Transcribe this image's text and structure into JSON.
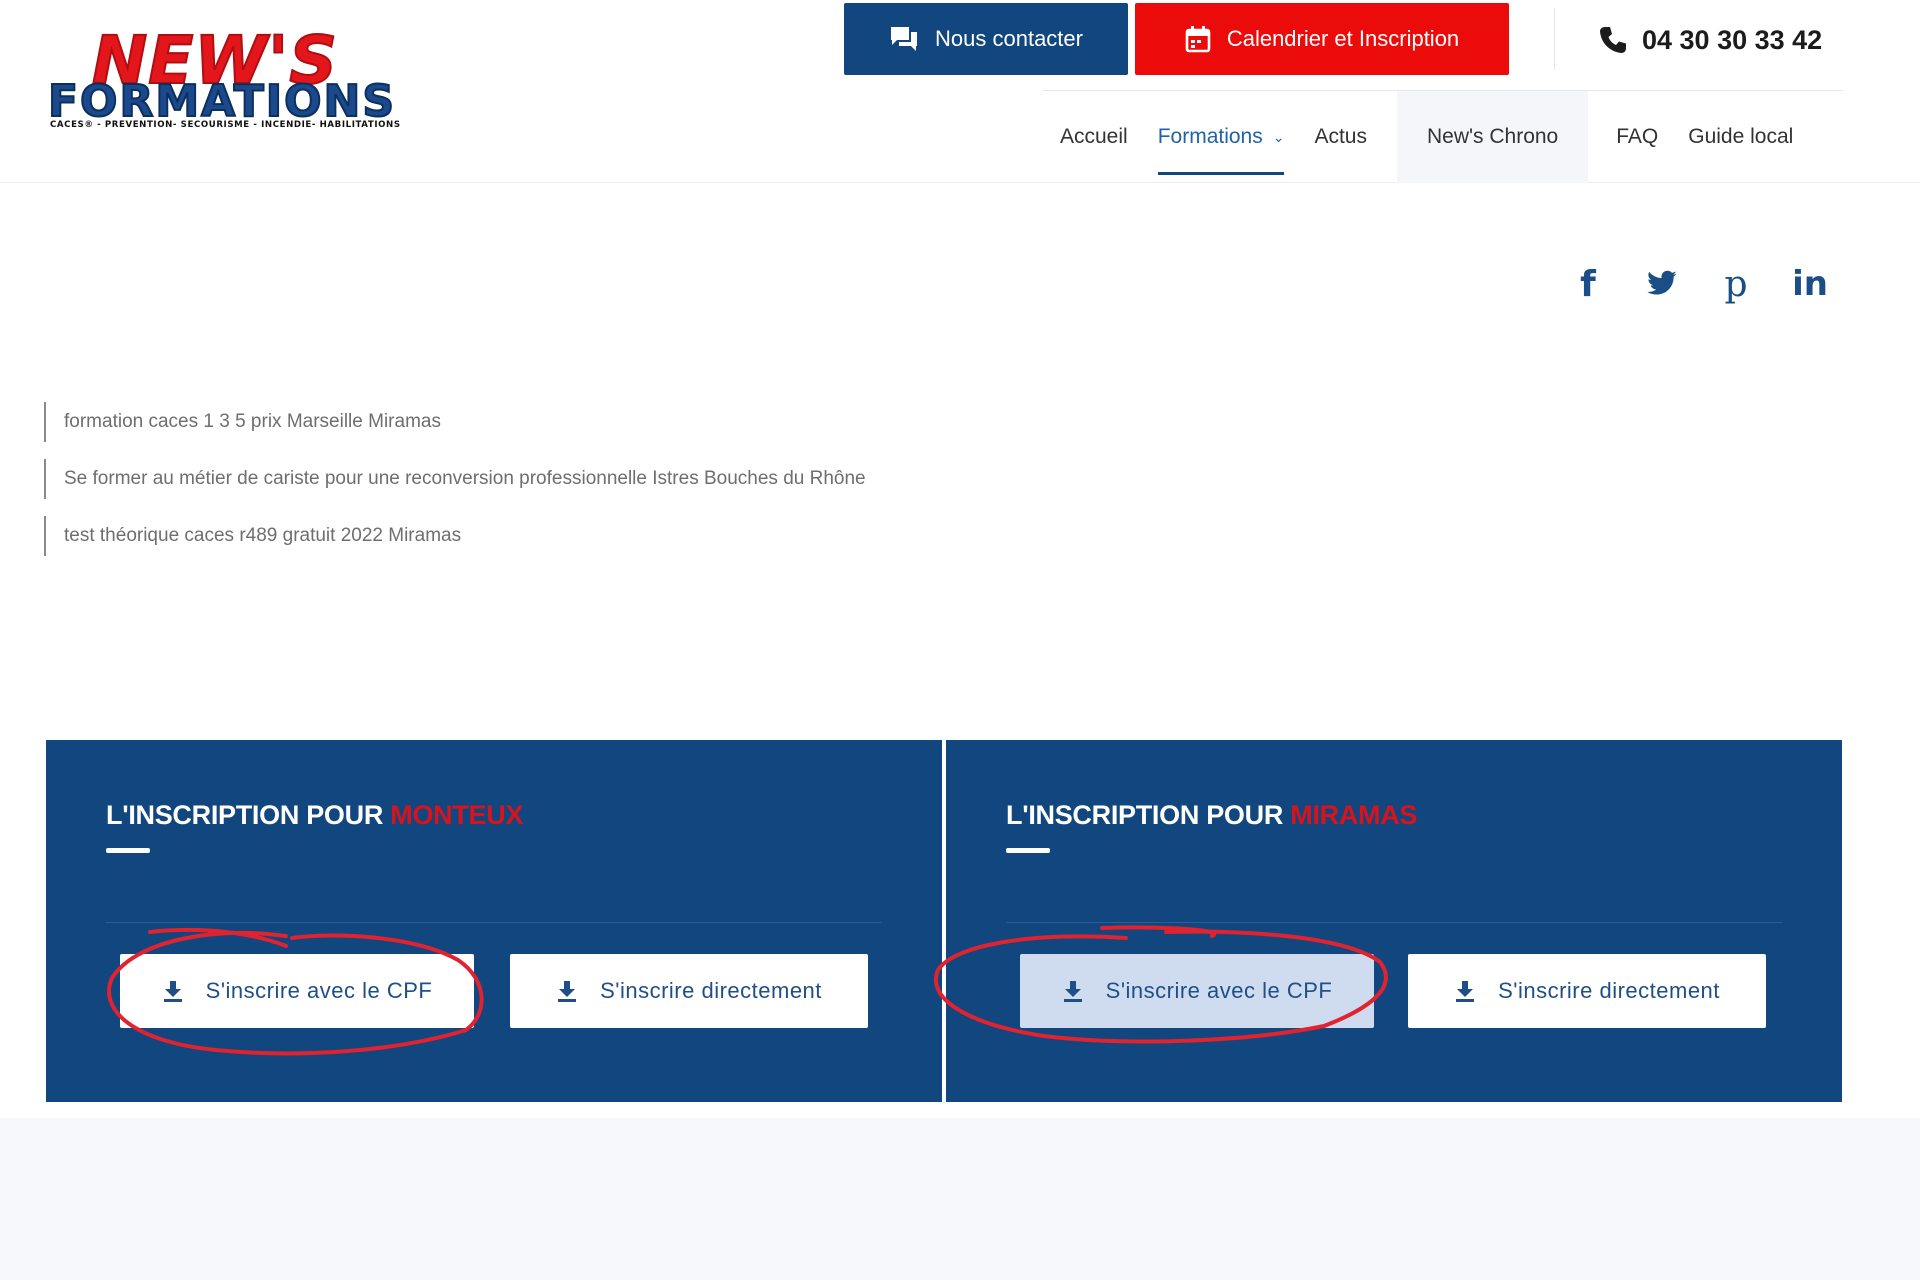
{
  "brand": {
    "line1": "NEW'S",
    "line2": "FORMATIONS",
    "tagline": "CACES® - PREVENTION- SECOURISME - INCENDIE- HABILITATIONS"
  },
  "header": {
    "contact_label": "Nous contacter",
    "calendar_label": "Calendrier et Inscription",
    "phone": "04 30 30 33 42"
  },
  "nav": {
    "items": [
      {
        "label": "Accueil"
      },
      {
        "label": "Formations"
      },
      {
        "label": "Actus"
      },
      {
        "label": "New's Chrono"
      },
      {
        "label": "FAQ"
      },
      {
        "label": "Guide local"
      }
    ]
  },
  "social": {
    "facebook": "f",
    "pinterest": "p",
    "linkedin": "in"
  },
  "links": [
    {
      "label": "formation caces 1 3 5 prix Marseille Miramas"
    },
    {
      "label": "Se former au métier de cariste pour une reconversion professionnelle Istres Bouches du Rhône"
    },
    {
      "label": "test théorique caces r489 gratuit 2022 Miramas"
    }
  ],
  "panels": [
    {
      "title_prefix": "L'INSCRIPTION POUR",
      "city": "MONTEUX",
      "cpf_label": "S'inscrire avec le CPF",
      "direct_label": "S'inscrire directement"
    },
    {
      "title_prefix": "L'INSCRIPTION POUR",
      "city": "MIRAMAS",
      "cpf_label": "S'inscrire avec le CPF",
      "direct_label": "S'inscrire directement"
    }
  ],
  "colors": {
    "primary": "#12467f",
    "accent_red": "#ec0b0b",
    "annotation": "#e0232f"
  }
}
